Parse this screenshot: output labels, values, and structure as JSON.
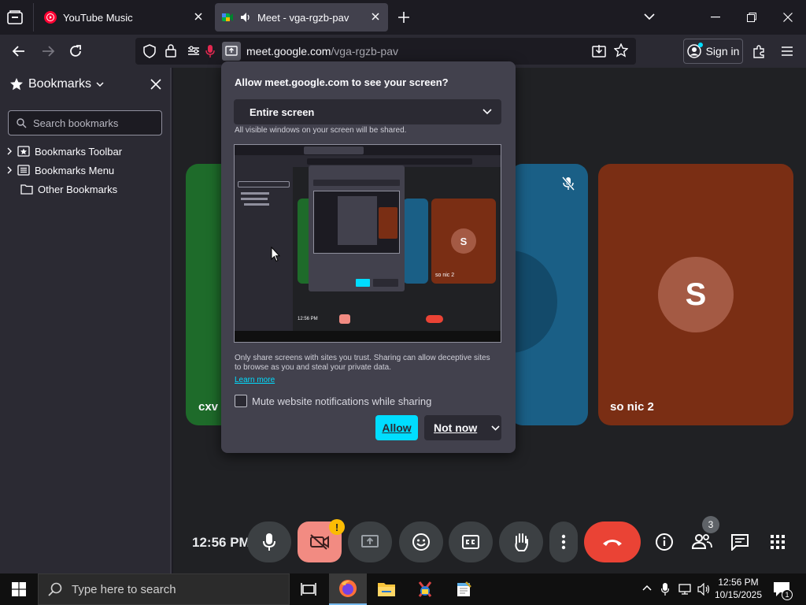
{
  "tabs": [
    {
      "title": "YouTube Music",
      "icon": "youtube-music-icon"
    },
    {
      "title": "Meet - vga-rgzb-pav",
      "icon": "meet-icon"
    }
  ],
  "navbar": {
    "url_host": "meet.google.com",
    "url_path": "/vga-rgzb-pav",
    "sign_in": "Sign in"
  },
  "sidebar": {
    "title": "Bookmarks",
    "search_placeholder": "Search bookmarks",
    "items": [
      {
        "label": "Bookmarks Toolbar"
      },
      {
        "label": "Bookmarks Menu"
      },
      {
        "label": "Other Bookmarks"
      }
    ]
  },
  "dialog": {
    "title": "Allow meet.google.com to see your screen?",
    "select_value": "Entire screen",
    "select_hint": "All visible windows on your screen will be shared.",
    "warning": "Only share screens with sites you trust. Sharing can allow deceptive sites to browse as you and steal your private data.",
    "learn_more": "Learn more",
    "mute_label": "Mute website notifications while sharing",
    "allow": "Allow",
    "not_now": "Not now"
  },
  "meet": {
    "tile_left_name": "cxv",
    "tile_right_name": "so nic 2",
    "tile_right_initial": "S",
    "time": "12:56 PM",
    "participants_badge": "3",
    "camera_warning": "!"
  },
  "preview": {
    "time": "12:56 PM",
    "tile_initial": "S",
    "tile_name": "so nic 2"
  },
  "taskbar": {
    "search_placeholder": "Type here to search",
    "clock_time": "12:56 PM",
    "clock_date": "10/15/2025",
    "notif_count": "1"
  },
  "colors": {
    "accent": "#00ddff",
    "hangup": "#ea4335",
    "camera_off": "#f28b82",
    "tile_green": "#1e6b2a",
    "tile_blue": "#1a5f86",
    "tile_orange": "#7a2e14"
  }
}
